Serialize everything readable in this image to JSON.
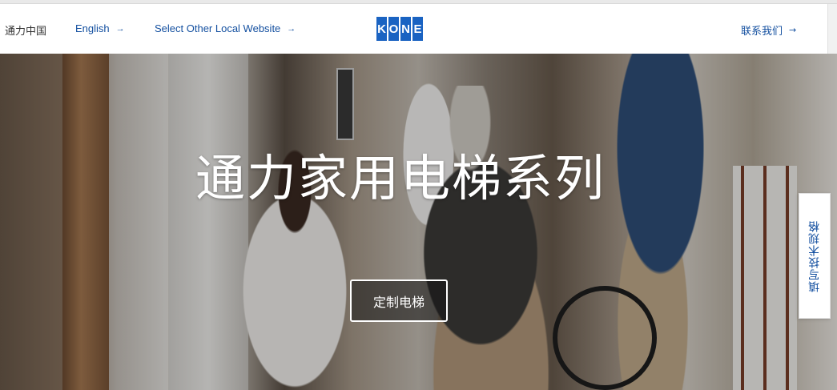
{
  "header": {
    "brand_text": "通力中国",
    "english_label": "English",
    "english_arrow": "→",
    "other_site_label": "Select Other Local Website",
    "other_site_arrow": "→",
    "contact_label": "联系我们",
    "contact_arrow": "→",
    "logo_letters": [
      "K",
      "O",
      "N",
      "E"
    ]
  },
  "hero": {
    "title": "通力家用电梯系列",
    "cta_label": "定制电梯"
  },
  "side_tab": {
    "label": "填写技术规格"
  },
  "colors": {
    "brand_blue": "#1a63c2",
    "link_blue": "#1450a0"
  }
}
